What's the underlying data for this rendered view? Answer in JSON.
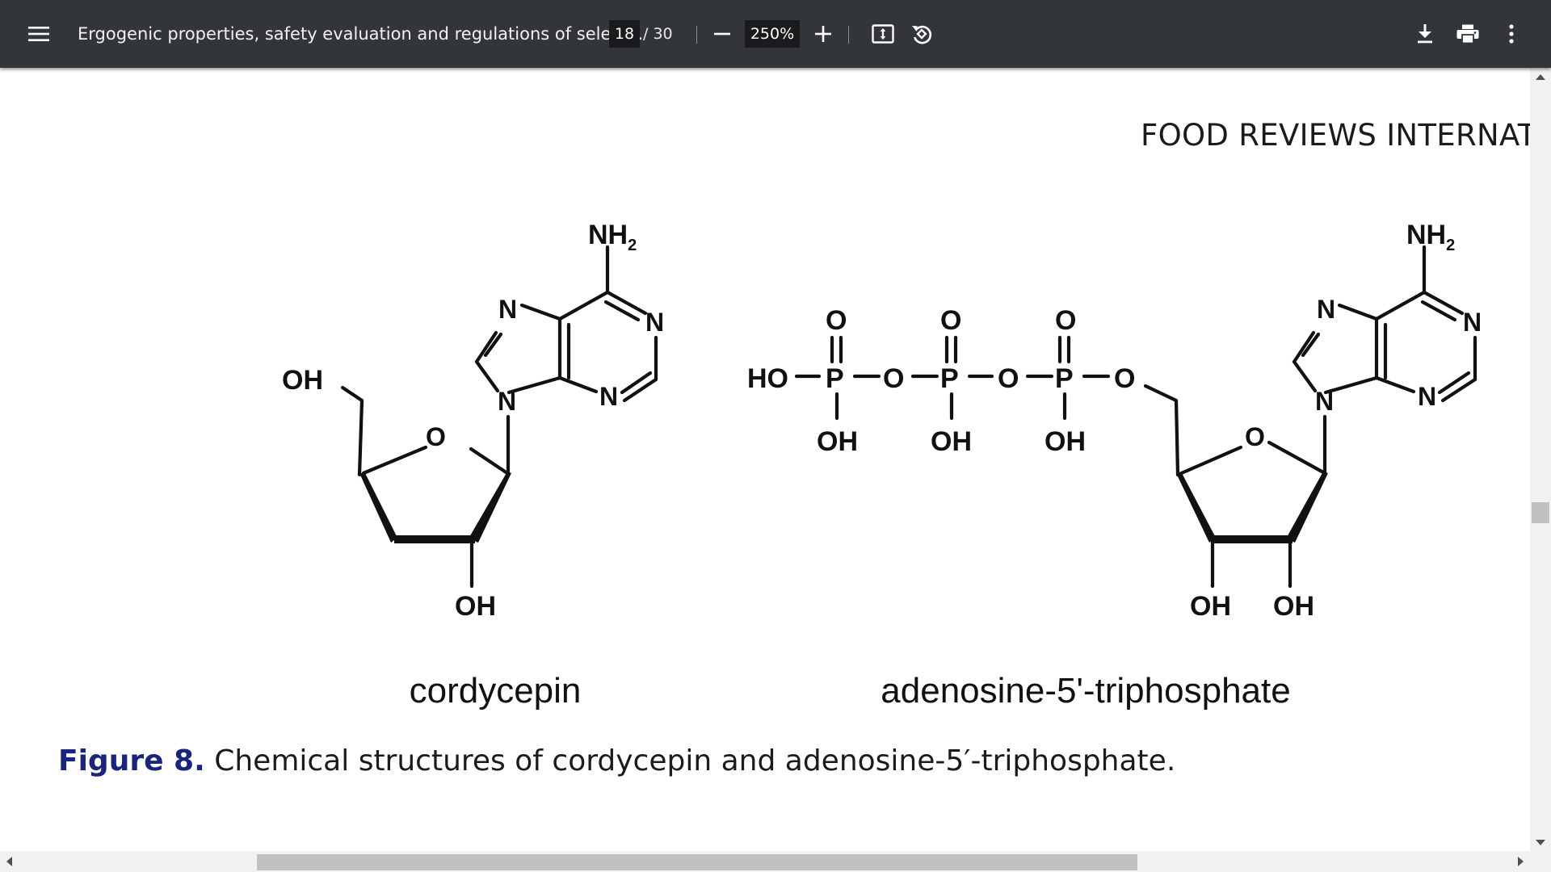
{
  "toolbar": {
    "title": "Ergogenic properties, safety evaluation and regulations of select...",
    "current_page": "18",
    "total_pages": "/ 30",
    "zoom": "250%",
    "icons": {
      "menu": "menu-icon",
      "zoom_out": "minus-icon",
      "zoom_in": "plus-icon",
      "fit": "fit-page-icon",
      "rotate": "rotate-icon",
      "download": "download-icon",
      "print": "print-icon",
      "more": "more-vert-icon"
    }
  },
  "page": {
    "running_head": "FOOD REVIEWS INTERNATION",
    "figure": {
      "left_name": "cordycepin",
      "right_name": "adenosine-5'-triphosphate",
      "atom_labels": {
        "nh2": "NH",
        "nh2_sub": "2",
        "n": "N",
        "o": "O",
        "oh": "OH",
        "ho": "HO",
        "p": "P"
      }
    },
    "caption": {
      "label": "Figure 8.",
      "text": "Chemical structures of cordycepin and adenosine-5′-triphosphate."
    }
  },
  "colors": {
    "toolbar_bg": "#323639",
    "caption_label": "#1a237e"
  }
}
